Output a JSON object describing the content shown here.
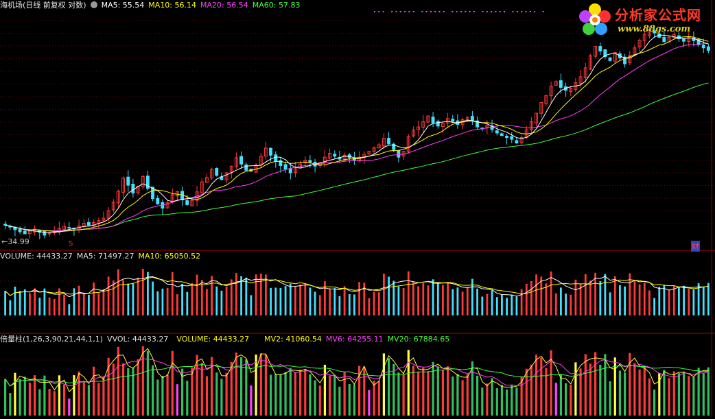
{
  "header": {
    "title": "海机场(日线 前复权 对数)",
    "ma5_label": "MA5: 55.54",
    "ma10_label": "MA10: 56.14",
    "ma20_label": "MA20: 56.54",
    "ma60_label": "MA60: 57.83"
  },
  "volume_header": {
    "volume_label": "VOLUME: 44433.27",
    "ma5_label": "MA5: 71497.27",
    "ma10_label": "MA10: 65050.52"
  },
  "indicator_header": {
    "name": "倍量柱(1,26,3,90,21,44,1,1)",
    "vvol_label": "VVOL: 44433.27",
    "volume_label": "VOLUME: 44433.27",
    "mv2_label": "MV2: 41060.54",
    "mv6_label": "MV6: 64255.11",
    "mv20_label": "MV20: 67884.65"
  },
  "annotations": {
    "low_price": "←34.99",
    "earnings_badge": "财",
    "ex_rights_marker": "S"
  },
  "logo": {
    "name": "分析家公式网",
    "url": "www.88gs.com"
  },
  "colors": {
    "up": "#ff3a3a",
    "down": "#40e0ff",
    "ma5": "#ffffff",
    "ma10": "#ffff00",
    "ma20": "#ff40ff",
    "ma60": "#40ff40",
    "grid": "#7a0000",
    "double_volume": "#ffff40",
    "low_volume": "#ff40ff",
    "text_gray": "#c8c8c8"
  },
  "chart_data": [
    {
      "type": "candlestick",
      "title": "海机场(日线 前复权 对数)",
      "scale": "log",
      "annotated_low": 34.99,
      "grid": true,
      "close_series": [
        36.5,
        36.2,
        35.8,
        35.5,
        35.2,
        35.6,
        35.9,
        35.4,
        35.0,
        35.3,
        35.6,
        36.0,
        36.3,
        36.1,
        35.9,
        36.4,
        36.8,
        36.5,
        36.9,
        37.2,
        37.6,
        38.8,
        40.2,
        42.1,
        44.5,
        43.2,
        41.8,
        43.0,
        44.8,
        42.6,
        40.8,
        39.9,
        39.2,
        40.1,
        41.5,
        42.0,
        40.6,
        39.8,
        40.5,
        42.0,
        43.8,
        44.6,
        46.2,
        45.0,
        44.2,
        45.5,
        46.8,
        48.5,
        47.2,
        46.0,
        45.8,
        47.0,
        48.8,
        50.5,
        49.0,
        47.8,
        46.9,
        46.2,
        45.5,
        46.3,
        47.2,
        48.0,
        47.6,
        46.8,
        47.5,
        48.6,
        49.4,
        48.8,
        48.2,
        49.0,
        48.5,
        47.9,
        48.6,
        49.2,
        49.8,
        50.5,
        51.2,
        52.6,
        51.4,
        50.2,
        48.6,
        49.8,
        53.0,
        54.5,
        55.2,
        56.4,
        57.8,
        56.2,
        55.4,
        56.0,
        57.2,
        56.5,
        55.8,
        56.9,
        57.5,
        56.6,
        55.2,
        54.8,
        55.5,
        54.6,
        53.8,
        53.2,
        52.8,
        52.4,
        51.6,
        52.8,
        54.5,
        56.4,
        58.5,
        61.2,
        63.0,
        65.5,
        66.8,
        65.2,
        64.4,
        65.0,
        66.5,
        68.2,
        70.8,
        74.5,
        77.5,
        76.0,
        74.2,
        73.0,
        75.5,
        73.8,
        72.0,
        74.6,
        77.0,
        79.5,
        81.5,
        83.0,
        82.0,
        80.5,
        79.0,
        80.5,
        81.5,
        80.0,
        79.2,
        80.6,
        79.4,
        78.0,
        77.0,
        76.2
      ],
      "volume_panel": {
        "volume": 44433.27,
        "ma5": 71497.27,
        "ma10": 65050.52
      },
      "indicator_panel": {
        "name": "倍量柱",
        "params": [
          1,
          26,
          3,
          90,
          21,
          44,
          1,
          1
        ],
        "vvol": 44433.27,
        "volume": 44433.27,
        "mv2": 41060.54,
        "mv6": 64255.11,
        "mv20": 67884.65
      }
    }
  ]
}
